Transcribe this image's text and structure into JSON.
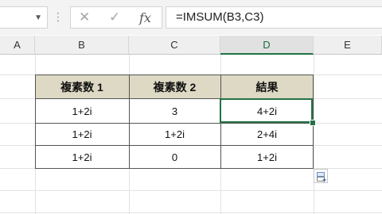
{
  "formula_bar": {
    "name_box_value": "",
    "cancel_icon": "close-icon",
    "enter_icon": "check-icon",
    "fx_label": "fx",
    "formula": "=IMSUM(B3,C3)"
  },
  "columns": [
    "A",
    "B",
    "C",
    "D",
    "E"
  ],
  "selected_column": "D",
  "table": {
    "headers": [
      "複素数 1",
      "複素数 2",
      "結果"
    ],
    "rows": [
      [
        "1+2i",
        "3",
        "4+2i"
      ],
      [
        "1+2i",
        "1+2i",
        "2+4i"
      ],
      [
        "1+2i",
        "0",
        "1+2i"
      ]
    ]
  },
  "active_cell": "D3",
  "colors": {
    "header_fill": "#ddd9c4",
    "accent": "#217346"
  },
  "quick_analysis_icon": "paste-options-icon"
}
